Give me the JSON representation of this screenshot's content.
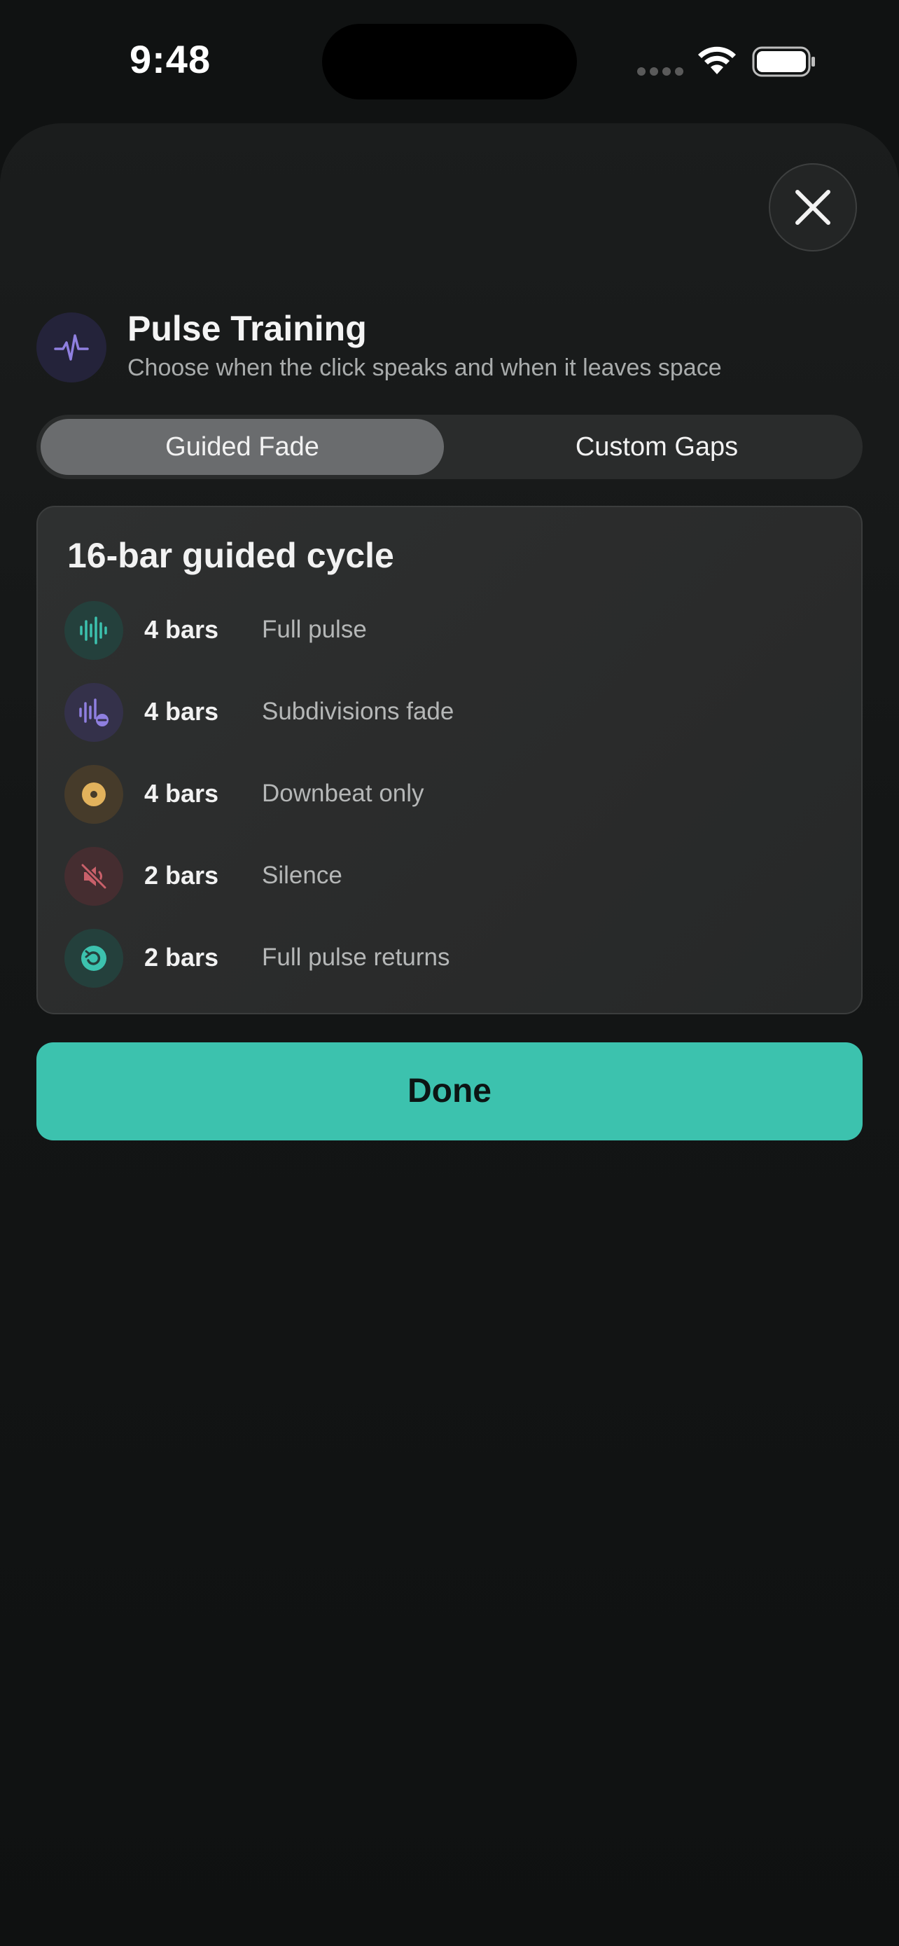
{
  "status_bar": {
    "time": "9:48"
  },
  "sheet": {
    "close_icon": "close-icon",
    "header": {
      "icon": "pulse-wave-icon",
      "title": "Pulse Training",
      "subtitle": "Choose when the click speaks and when it leaves space"
    },
    "tabs": [
      {
        "label": "Guided Fade",
        "selected": true
      },
      {
        "label": "Custom Gaps",
        "selected": false
      }
    ],
    "card": {
      "title": "16-bar guided cycle",
      "steps": [
        {
          "bars": "4 bars",
          "label": "Full pulse",
          "icon": "full-pulse-icon",
          "color": "#3cc2ae"
        },
        {
          "bars": "4 bars",
          "label": "Subdivisions fade",
          "icon": "subdivisions-fade-icon",
          "color": "#8f7fe0"
        },
        {
          "bars": "4 bars",
          "label": "Downbeat only",
          "icon": "downbeat-icon",
          "color": "#e2b25c"
        },
        {
          "bars": "2 bars",
          "label": "Silence",
          "icon": "muted-speaker-icon",
          "color": "#c9606a"
        },
        {
          "bars": "2 bars",
          "label": "Full pulse returns",
          "icon": "return-arrow-icon",
          "color": "#3cc2ae"
        }
      ]
    },
    "done_label": "Done"
  },
  "colors": {
    "accent": "#3cc2ae",
    "background": "#101212",
    "card": "#2c2e2e"
  }
}
